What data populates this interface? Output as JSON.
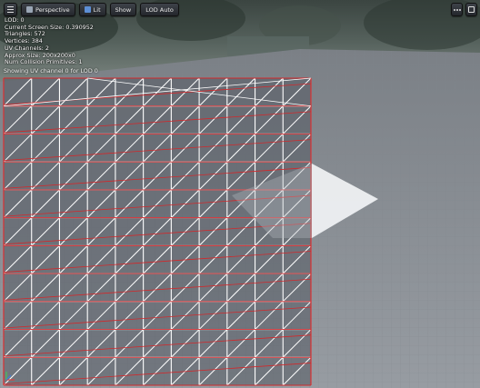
{
  "toolbar": {
    "menu_icon": "hamburger-menu-icon",
    "perspective_label": "Perspective",
    "lit_label": "Lit",
    "show_label": "Show",
    "lod_label": "LOD Auto",
    "right_icons": [
      "options-icon",
      "maximize-icon"
    ]
  },
  "stats": {
    "lod": "LOD:  0",
    "screen_size": "Current Screen Size:  0.390952",
    "triangles": "Triangles:  572",
    "vertices": "Vertices:  384",
    "uv_channels": "UV Channels:  2",
    "approx_size": "Approx Size: 200x200x0",
    "collision": "Num Collision Primitives:  1"
  },
  "uv_note": "Showing UV channel 0 for LOD 0",
  "colors": {
    "uv_wire": "#ffffff",
    "uv_seam": "#d2282b",
    "floor": "#8b9096",
    "sky": "#2d3633"
  }
}
